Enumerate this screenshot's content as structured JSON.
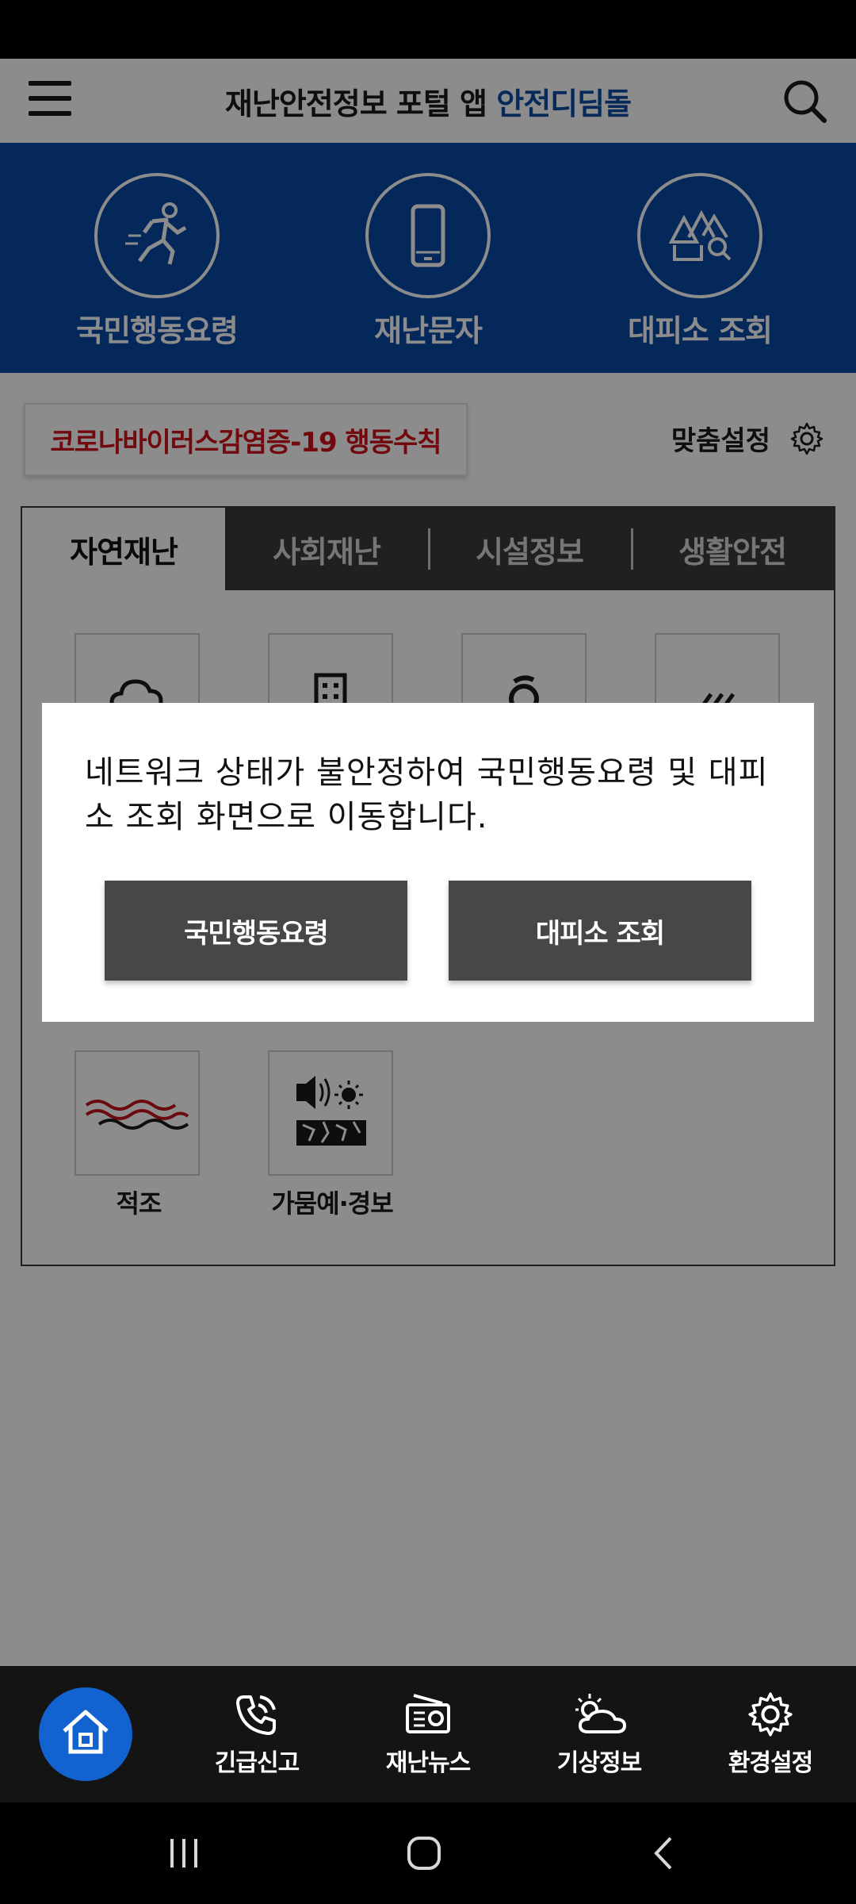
{
  "header": {
    "title_main": "재난안전정보 포털 앱",
    "title_accent": "안전디딤돌"
  },
  "hero": {
    "items": [
      {
        "label": "국민행동요령",
        "icon": "running-person-icon"
      },
      {
        "label": "재난문자",
        "icon": "smartphone-icon"
      },
      {
        "label": "대피소 조회",
        "icon": "shelter-search-icon"
      }
    ]
  },
  "content": {
    "covid_button": "코로나바이러스감염증-19 행동수칙",
    "custom_setting_label": "맞춤설정"
  },
  "tabs": [
    {
      "label": "자연재난",
      "active": true
    },
    {
      "label": "사회재난",
      "active": false
    },
    {
      "label": "시설정보",
      "active": false
    },
    {
      "label": "생활안전",
      "active": false
    }
  ],
  "grid": {
    "items": [
      {
        "label": "",
        "icon": "cloud-icon"
      },
      {
        "label": "",
        "icon": "building-icon"
      },
      {
        "label": "",
        "icon": "typhoon-icon"
      },
      {
        "label": "",
        "icon": "rain-icon"
      },
      {
        "label": "적조",
        "icon": "red-tide-icon"
      },
      {
        "label": "가뭄예·경보",
        "icon": "drought-alert-icon"
      }
    ]
  },
  "dialog": {
    "message": "네트워크 상태가 불안정하여 국민행동요령 및 대피소 조회 화면으로 이동합니다.",
    "button_left": "국민행동요령",
    "button_right": "대피소 조회"
  },
  "bottom_nav": {
    "items": [
      {
        "label": "",
        "icon": "home-icon"
      },
      {
        "label": "긴급신고",
        "icon": "phone-call-icon"
      },
      {
        "label": "재난뉴스",
        "icon": "radio-icon"
      },
      {
        "label": "기상정보",
        "icon": "weather-icon"
      },
      {
        "label": "환경설정",
        "icon": "gear-icon"
      }
    ]
  },
  "colors": {
    "brand_blue": "#0a4aa6",
    "accent_red": "#d0121b",
    "dark_gray": "#474747"
  }
}
